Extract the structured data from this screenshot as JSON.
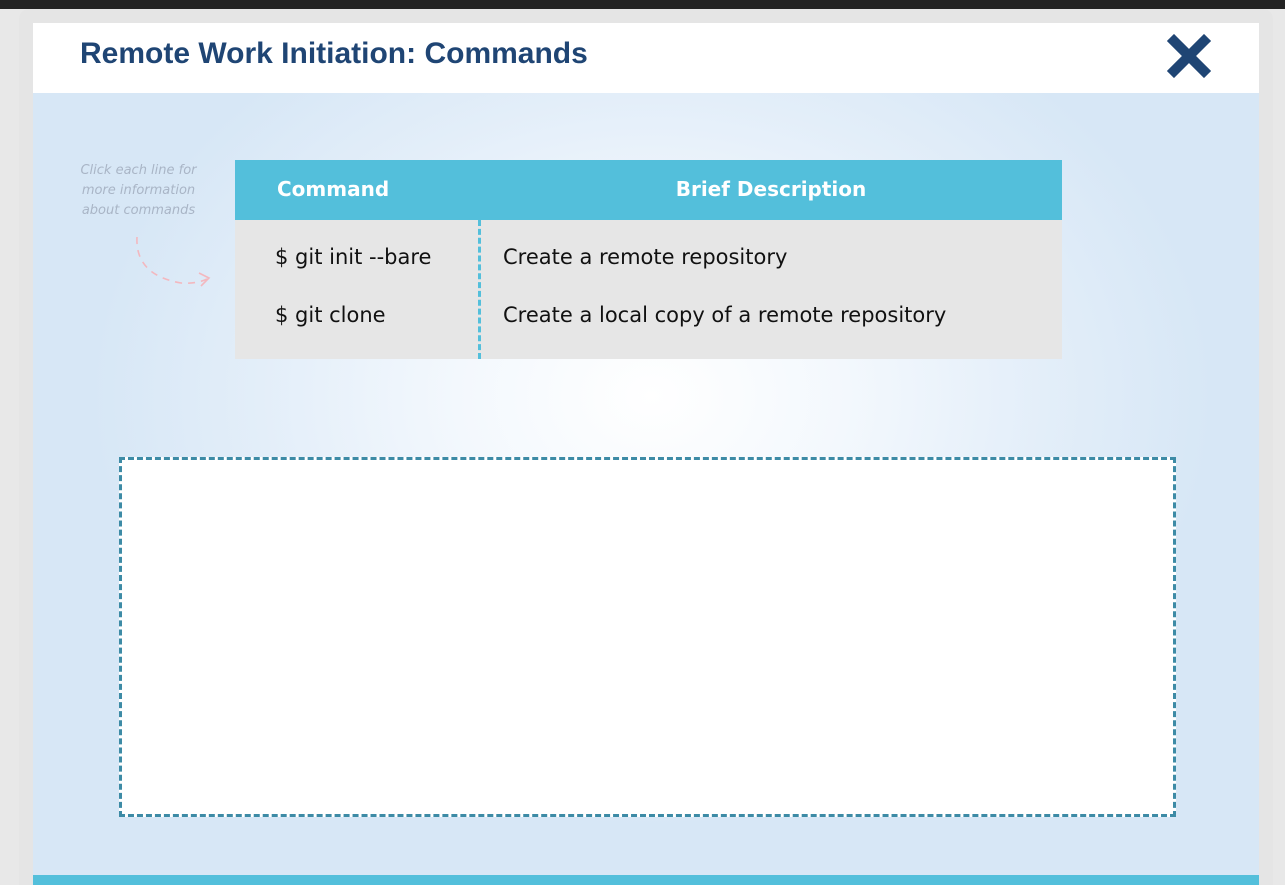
{
  "window": {
    "title": "Remote Work Initiation: Commands",
    "close_icon": "close-x-icon"
  },
  "hint": {
    "text": "Click each line for more information about commands",
    "icon": "dashed-curved-arrow-icon"
  },
  "table": {
    "headers": {
      "command": "Command",
      "description": "Brief Description"
    },
    "rows": [
      {
        "command": "$ git init --bare",
        "description": "Create a remote repository"
      },
      {
        "command": "$ git clone",
        "description": "Create a local copy of a remote repository"
      }
    ]
  },
  "info_box": {
    "content": ""
  },
  "colors": {
    "title": "#1f4574",
    "accent": "#53bfdb",
    "box_border": "#3d8ba6",
    "row_bg": "#e6e6e6"
  }
}
